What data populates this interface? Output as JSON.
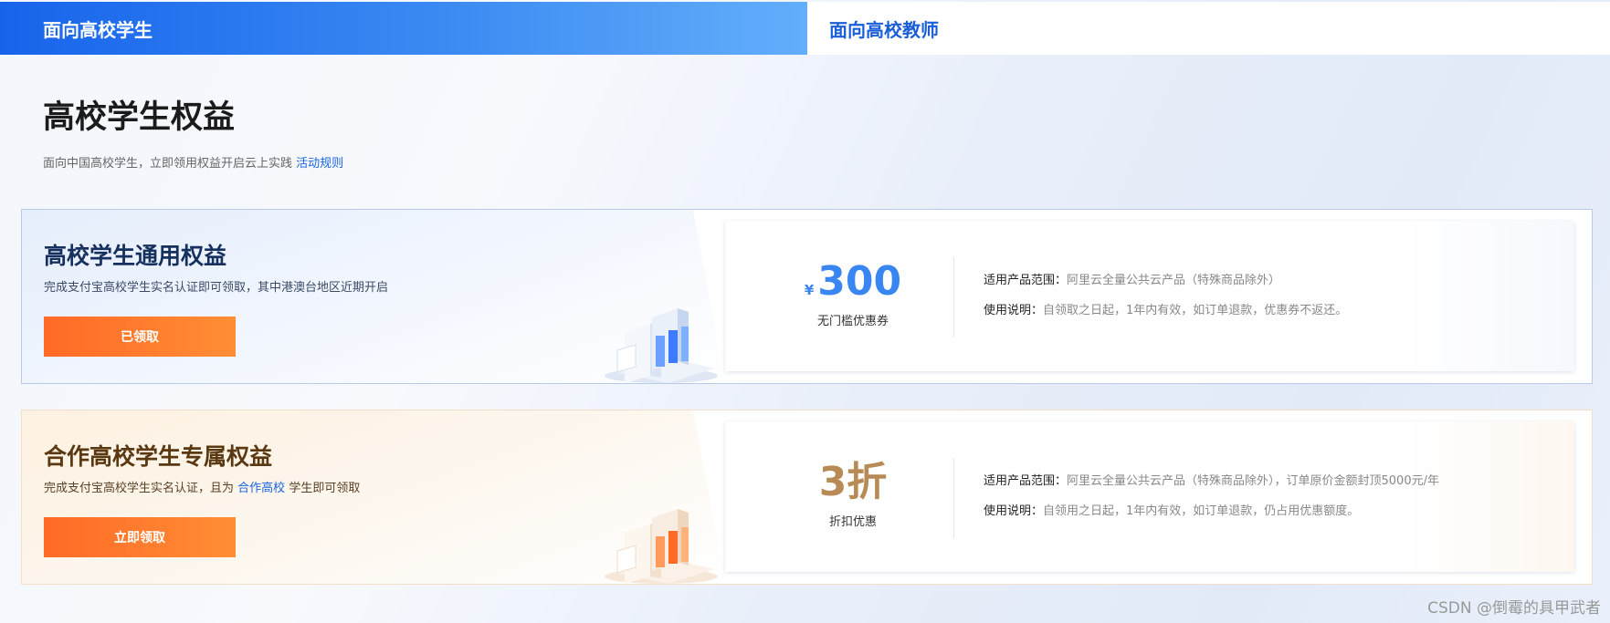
{
  "tabs": [
    {
      "label": "面向高校学生",
      "active": true
    },
    {
      "label": "面向高校教师",
      "active": false
    }
  ],
  "header": {
    "title": "高校学生权益",
    "subtitle": "面向中国高校学生，立即领用权益开启云上实践",
    "rules_link": "活动规则"
  },
  "cards": [
    {
      "title": "高校学生通用权益",
      "desc": "完成支付宝高校学生实名认证即可领取，其中港澳台地区近期开启",
      "button": "已领取",
      "currency": "¥",
      "amount": "300",
      "value_caption": "无门槛优惠券",
      "scope_label": "适用产品范围：",
      "scope_value": "阿里云全量公共云产品（特殊商品除外）",
      "usage_label": "使用说明：",
      "usage_value": "自领取之日起，1年内有效，如订单退款，优惠券不返还。",
      "accent": "#3a86f0"
    },
    {
      "title": "合作高校学生专属权益",
      "desc_before": "完成支付宝高校学生实名认证，且为",
      "desc_link": "合作高校",
      "desc_after": "学生即可领取",
      "button": "立即领取",
      "amount": "3折",
      "value_caption": "折扣优惠",
      "scope_label": "适用产品范围：",
      "scope_value": "阿里云全量公共云产品（特殊商品除外），订单原价金额封顶5000元/年",
      "usage_label": "使用说明：",
      "usage_value": "自领用之日起，1年内有效，如订单退款，仍占用优惠额度。",
      "accent": "#b88a55"
    }
  ],
  "watermark": "CSDN @倒霉的具甲武者",
  "colors": {
    "primary_blue": "#1764ec",
    "button_orange": "#ff6a26",
    "link_blue": "#1a66e0"
  }
}
